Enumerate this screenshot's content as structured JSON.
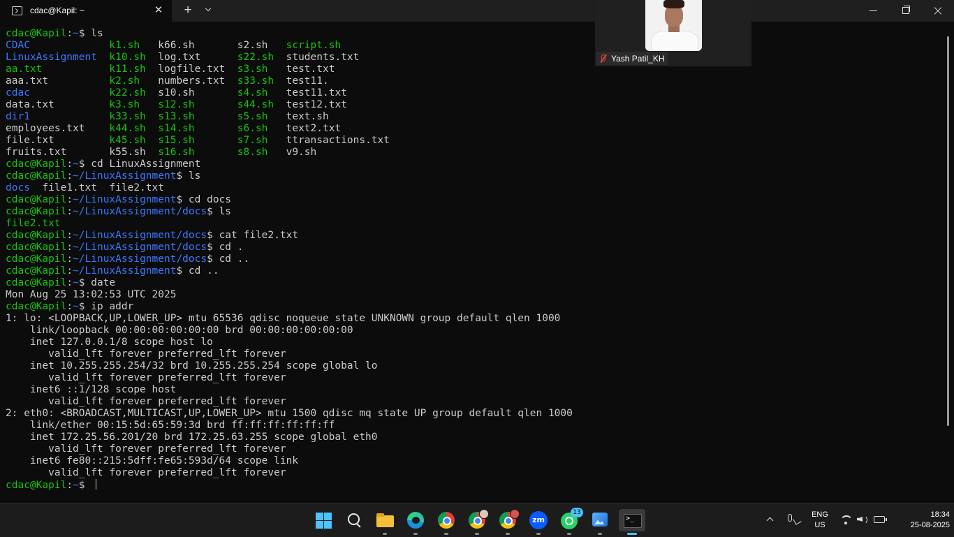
{
  "window": {
    "tab_title": "cdac@Kapil: ~",
    "close_tab_glyph": "✕",
    "new_tab_glyph": "+"
  },
  "colors": {
    "background": "#0c0c0c",
    "foreground": "#cccccc",
    "prompt_user": "#16c60c",
    "prompt_path": "#3b78ff",
    "directory": "#3b78ff",
    "executable": "#16c60c"
  },
  "terminal": {
    "lines": [
      [
        [
          "u",
          "cdac@Kapil"
        ],
        [
          "t",
          ":"
        ],
        [
          "p",
          "~"
        ],
        [
          "t",
          "$ ls"
        ]
      ],
      [
        [
          "d",
          "CDAC"
        ],
        [
          "t",
          "             "
        ],
        [
          "x",
          "k1.sh"
        ],
        [
          "t",
          "   k66.sh       s2.sh   "
        ],
        [
          "x",
          "script.sh"
        ]
      ],
      [
        [
          "d",
          "LinuxAssignment"
        ],
        [
          "t",
          "  "
        ],
        [
          "x",
          "k10.sh"
        ],
        [
          "t",
          "  log.txt      "
        ],
        [
          "x",
          "s22.sh"
        ],
        [
          "t",
          "  students.txt"
        ]
      ],
      [
        [
          "x",
          "aa.txt"
        ],
        [
          "t",
          "           "
        ],
        [
          "x",
          "k11.sh"
        ],
        [
          "t",
          "  logfile.txt  "
        ],
        [
          "x",
          "s3.sh"
        ],
        [
          "t",
          "   test.txt"
        ]
      ],
      [
        [
          "t",
          "aaa.txt          "
        ],
        [
          "x",
          "k2.sh"
        ],
        [
          "t",
          "   numbers.txt  "
        ],
        [
          "x",
          "s33.sh"
        ],
        [
          "t",
          "  test11."
        ]
      ],
      [
        [
          "d",
          "cdac"
        ],
        [
          "t",
          "             "
        ],
        [
          "x",
          "k22.sh"
        ],
        [
          "t",
          "  s10.sh       "
        ],
        [
          "x",
          "s4.sh"
        ],
        [
          "t",
          "   test11.txt"
        ]
      ],
      [
        [
          "t",
          "data.txt         "
        ],
        [
          "x",
          "k3.sh"
        ],
        [
          "t",
          "   "
        ],
        [
          "x",
          "s12.sh"
        ],
        [
          "t",
          "       "
        ],
        [
          "x",
          "s44.sh"
        ],
        [
          "t",
          "  test12.txt"
        ]
      ],
      [
        [
          "d",
          "dir1"
        ],
        [
          "t",
          "             "
        ],
        [
          "x",
          "k33.sh"
        ],
        [
          "t",
          "  "
        ],
        [
          "x",
          "s13.sh"
        ],
        [
          "t",
          "       "
        ],
        [
          "x",
          "s5.sh"
        ],
        [
          "t",
          "   text.sh"
        ]
      ],
      [
        [
          "t",
          "employees.txt    "
        ],
        [
          "x",
          "k44.sh"
        ],
        [
          "t",
          "  "
        ],
        [
          "x",
          "s14.sh"
        ],
        [
          "t",
          "       "
        ],
        [
          "x",
          "s6.sh"
        ],
        [
          "t",
          "   text2.txt"
        ]
      ],
      [
        [
          "t",
          "file.txt         "
        ],
        [
          "x",
          "k45.sh"
        ],
        [
          "t",
          "  "
        ],
        [
          "x",
          "s15.sh"
        ],
        [
          "t",
          "       "
        ],
        [
          "x",
          "s7.sh"
        ],
        [
          "t",
          "   ttransactions.txt"
        ]
      ],
      [
        [
          "t",
          "fruits.txt       k55.sh  "
        ],
        [
          "x",
          "s16.sh"
        ],
        [
          "t",
          "       "
        ],
        [
          "x",
          "s8.sh"
        ],
        [
          "t",
          "   v9.sh"
        ]
      ],
      [
        [
          "u",
          "cdac@Kapil"
        ],
        [
          "t",
          ":"
        ],
        [
          "p",
          "~"
        ],
        [
          "t",
          "$ cd LinuxAssignment"
        ]
      ],
      [
        [
          "u",
          "cdac@Kapil"
        ],
        [
          "t",
          ":"
        ],
        [
          "p",
          "~/LinuxAssignment"
        ],
        [
          "t",
          "$ ls"
        ]
      ],
      [
        [
          "d",
          "docs"
        ],
        [
          "t",
          "  file1.txt  file2.txt"
        ]
      ],
      [
        [
          "u",
          "cdac@Kapil"
        ],
        [
          "t",
          ":"
        ],
        [
          "p",
          "~/LinuxAssignment"
        ],
        [
          "t",
          "$ cd docs"
        ]
      ],
      [
        [
          "u",
          "cdac@Kapil"
        ],
        [
          "t",
          ":"
        ],
        [
          "p",
          "~/LinuxAssignment/docs"
        ],
        [
          "t",
          "$ ls"
        ]
      ],
      [
        [
          "x",
          "file2.txt"
        ]
      ],
      [
        [
          "u",
          "cdac@Kapil"
        ],
        [
          "t",
          ":"
        ],
        [
          "p",
          "~/LinuxAssignment/docs"
        ],
        [
          "t",
          "$ cat file2.txt"
        ]
      ],
      [
        [
          "u",
          "cdac@Kapil"
        ],
        [
          "t",
          ":"
        ],
        [
          "p",
          "~/LinuxAssignment/docs"
        ],
        [
          "t",
          "$ cd ."
        ]
      ],
      [
        [
          "u",
          "cdac@Kapil"
        ],
        [
          "t",
          ":"
        ],
        [
          "p",
          "~/LinuxAssignment/docs"
        ],
        [
          "t",
          "$ cd .."
        ]
      ],
      [
        [
          "u",
          "cdac@Kapil"
        ],
        [
          "t",
          ":"
        ],
        [
          "p",
          "~/LinuxAssignment"
        ],
        [
          "t",
          "$ cd .."
        ]
      ],
      [
        [
          "u",
          "cdac@Kapil"
        ],
        [
          "t",
          ":"
        ],
        [
          "p",
          "~"
        ],
        [
          "t",
          "$ date"
        ]
      ],
      [
        [
          "t",
          "Mon Aug 25 13:02:53 UTC 2025"
        ]
      ],
      [
        [
          "u",
          "cdac@Kapil"
        ],
        [
          "t",
          ":"
        ],
        [
          "p",
          "~"
        ],
        [
          "t",
          "$ ip addr"
        ]
      ],
      [
        [
          "t",
          "1: lo: <LOOPBACK,UP,LOWER_UP> mtu 65536 qdisc noqueue state UNKNOWN group default qlen 1000"
        ]
      ],
      [
        [
          "t",
          "    link/loopback 00:00:00:00:00:00 brd 00:00:00:00:00:00"
        ]
      ],
      [
        [
          "t",
          "    inet 127.0.0.1/8 scope host lo"
        ]
      ],
      [
        [
          "t",
          "       valid_lft forever preferred_lft forever"
        ]
      ],
      [
        [
          "t",
          "    inet 10.255.255.254/32 brd 10.255.255.254 scope global lo"
        ]
      ],
      [
        [
          "t",
          "       valid_lft forever preferred_lft forever"
        ]
      ],
      [
        [
          "t",
          "    inet6 ::1/128 scope host"
        ]
      ],
      [
        [
          "t",
          "       valid_lft forever preferred_lft forever"
        ]
      ],
      [
        [
          "t",
          "2: eth0: <BROADCAST,MULTICAST,UP,LOWER_UP> mtu 1500 qdisc mq state UP group default qlen 1000"
        ]
      ],
      [
        [
          "t",
          "    link/ether 00:15:5d:65:59:3d brd ff:ff:ff:ff:ff:ff"
        ]
      ],
      [
        [
          "t",
          "    inet 172.25.56.201/20 brd 172.25.63.255 scope global eth0"
        ]
      ],
      [
        [
          "t",
          "       valid_lft forever preferred_lft forever"
        ]
      ],
      [
        [
          "t",
          "    inet6 fe80::215:5dff:fe65:593d/64 scope link"
        ]
      ],
      [
        [
          "t",
          "       valid_lft forever preferred_lft forever"
        ]
      ],
      [
        [
          "u",
          "cdac@Kapil"
        ],
        [
          "t",
          ":"
        ],
        [
          "p",
          "~"
        ],
        [
          "t",
          "$ "
        ]
      ]
    ]
  },
  "video_overlay": {
    "participant_name": "Yash Patil_KH",
    "mic_icon": "mic-muted-icon"
  },
  "taskbar": {
    "apps": [
      {
        "name": "start-button",
        "icon": "windows-logo-icon"
      },
      {
        "name": "search-button",
        "icon": "search-icon"
      },
      {
        "name": "file-explorer",
        "icon": "folder-icon"
      },
      {
        "name": "edge-browser",
        "icon": "edge-icon"
      },
      {
        "name": "chrome-1",
        "icon": "chrome-icon"
      },
      {
        "name": "chrome-2",
        "icon": "chrome-icon"
      },
      {
        "name": "chrome-3",
        "icon": "chrome-icon"
      },
      {
        "name": "zoom-app",
        "icon": "zoom-icon"
      },
      {
        "name": "whatsapp-app",
        "icon": "whatsapp-icon"
      },
      {
        "name": "photos-app",
        "icon": "photos-icon"
      },
      {
        "name": "terminal-app",
        "icon": "terminal-icon"
      }
    ],
    "zoom_label": "zm",
    "whatsapp_badge": "13",
    "lang_primary": "ENG",
    "lang_secondary": "US",
    "time": "18:34",
    "date": "25-08-2025"
  }
}
